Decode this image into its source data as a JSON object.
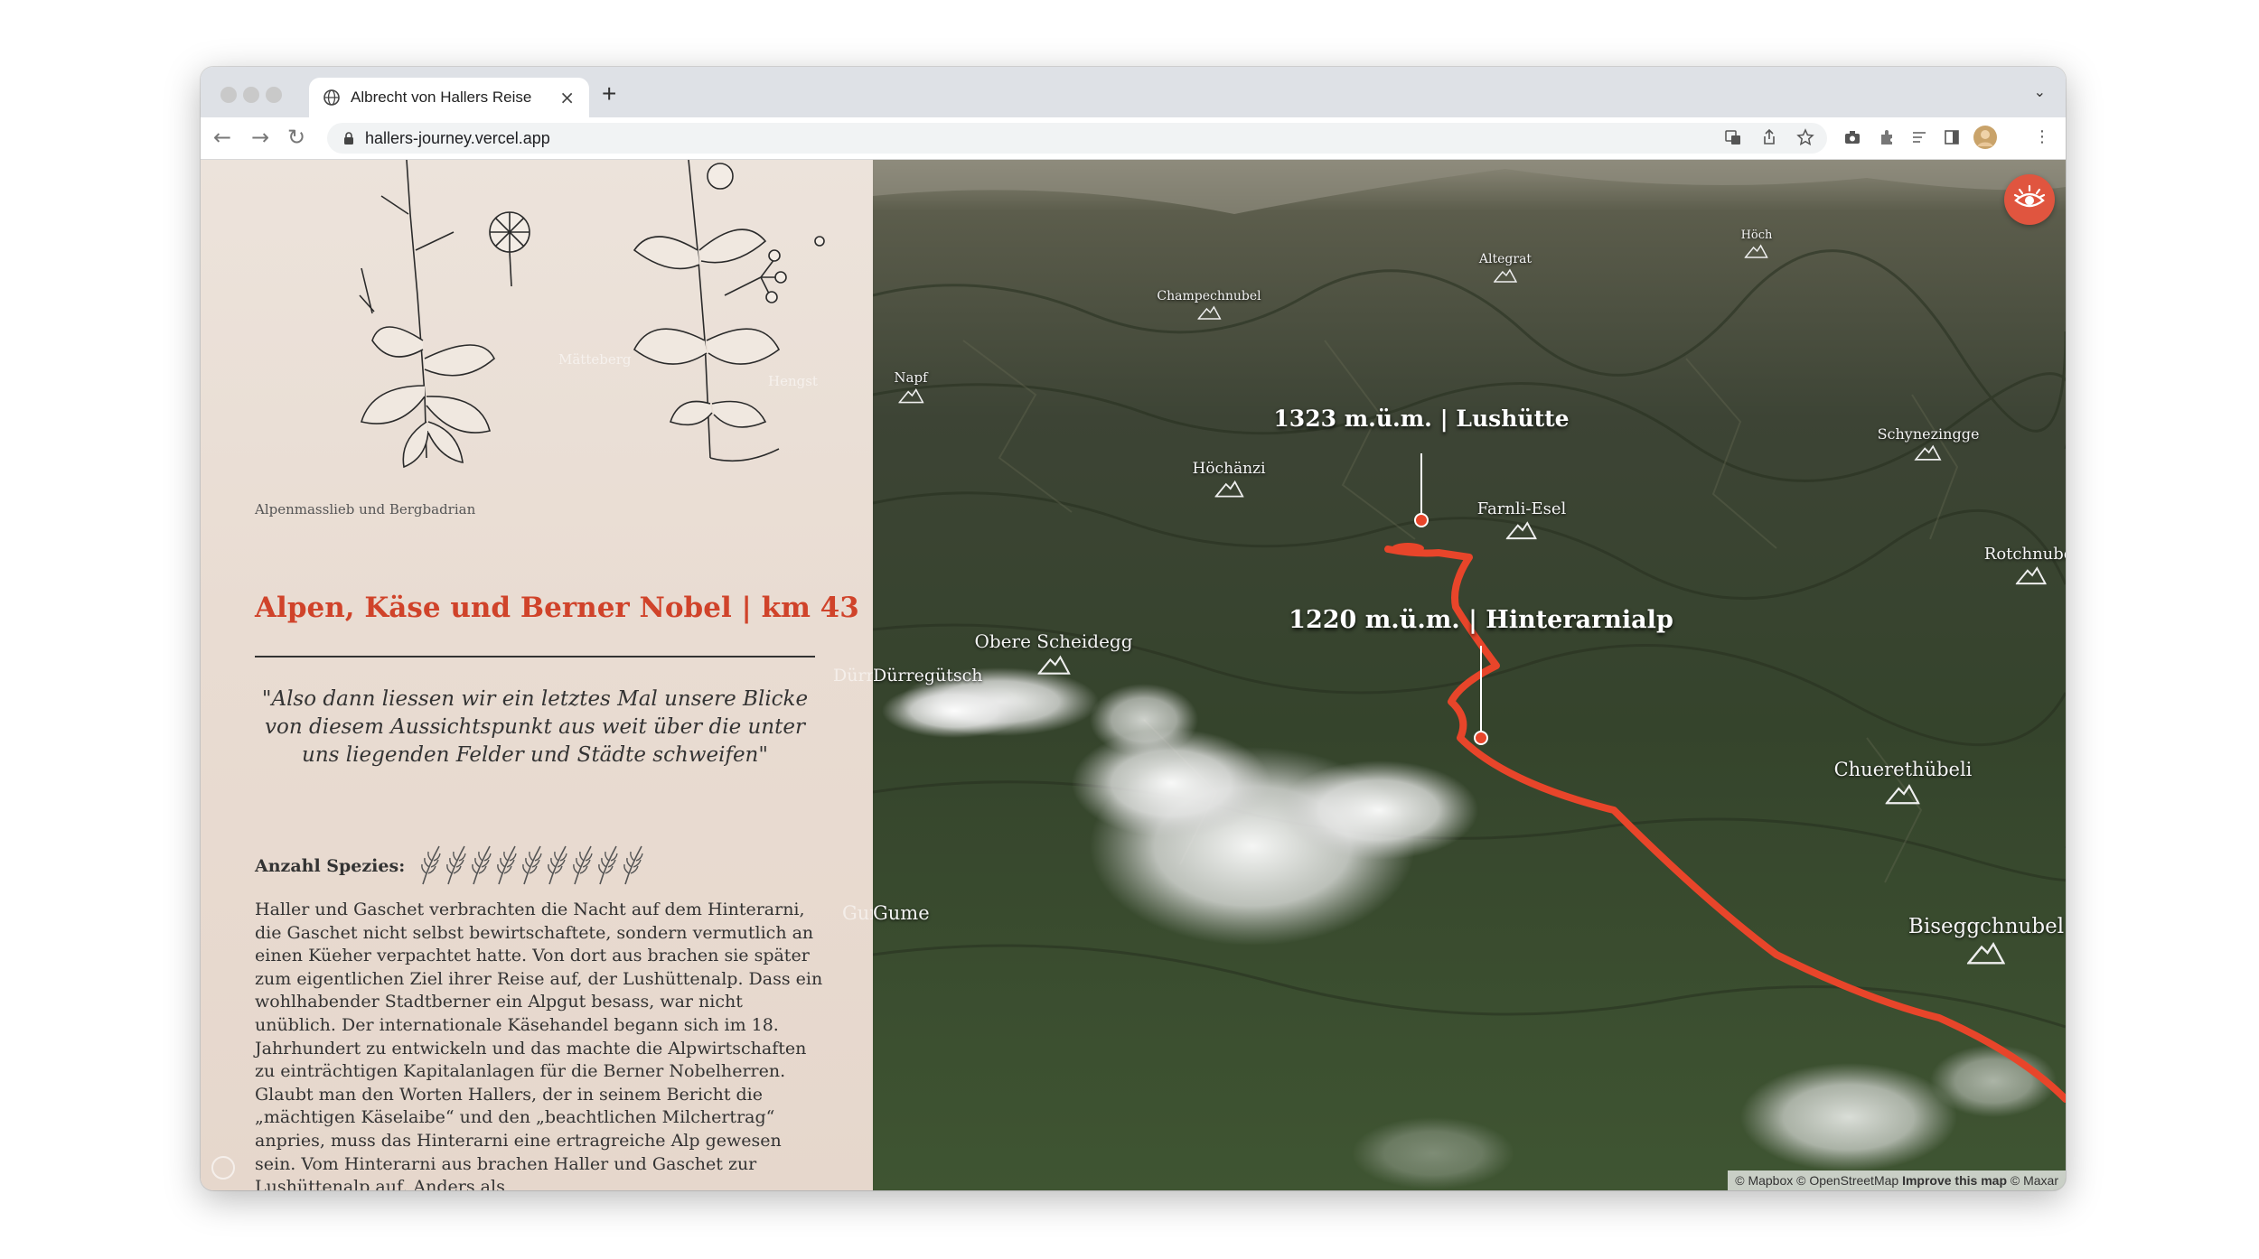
{
  "browser": {
    "tab_title": "Albrecht von Hallers Reise",
    "tab_close": "×",
    "new_tab": "+",
    "url": "hallers-journey.vercel.app"
  },
  "sidebar": {
    "illustration_caption": "Alpenmasslieb und Bergbadrian",
    "section_title": "Alpen, Käse und Berner Nobel | km 43",
    "quote": "\"Also dann liessen wir ein letztes Mal unsere Blicke von diesem Aussichtspunkt aus weit über die unter uns liegenden Felder und Städte schweifen\"",
    "species_label": "Anzahl Spezies:",
    "species_count": 9,
    "body": "Haller und Gaschet verbrachten die Nacht auf dem Hinterarni, die Gaschet nicht selbst bewirtschaftete, sondern vermutlich an einen Küeher verpachtet hatte. Von dort aus brachen sie später zum eigentlichen Ziel ihrer Reise auf, der Lushüttenalp. Dass ein wohlhabender Stadtberner ein Alpgut besass, war nicht unüblich. Der internationale Käsehandel begann sich im 18. Jahrhundert zu entwickeln und das machte die Alpwirtschaften zu einträchtigen Kapitalanlagen für die Berner Nobelherren. Glaubt man den Worten Hallers, der in seinem Bericht die „mächtigen Käselaibe“ und den „beachtlichen Milchertrag“ anpries, muss das Hinterarni eine ertragreiche Alp gewesen sein. Vom Hinterarni aus brachen Haller und Gaschet zur Lushüttenalp auf. Anders als",
    "ghost_labels": [
      "Mätteberg",
      "Hengst",
      "Dürregütsch",
      "Gume"
    ]
  },
  "map": {
    "peaks": [
      "Höch",
      "Altegrat",
      "Champechnubel",
      "Napf",
      "Schynezingge",
      "Höchänzi",
      "Farnli-Esel",
      "Rotchnubel",
      "Obere Scheidegg",
      "Dürregütsch",
      "Chuerethübeli",
      "Gume",
      "Biseggchnubel"
    ],
    "callouts": {
      "lushuette": "1323 m.ü.m. | Lushütte",
      "hinterarnialp": "1220 m.ü.m. | Hinterarnialp"
    },
    "attribution": {
      "mapbox": "© Mapbox",
      "osm": "© OpenStreetMap",
      "improve": "Improve this map",
      "maxar": "© Maxar"
    },
    "route_color": "#e8452a",
    "accent": "#d0432a"
  }
}
